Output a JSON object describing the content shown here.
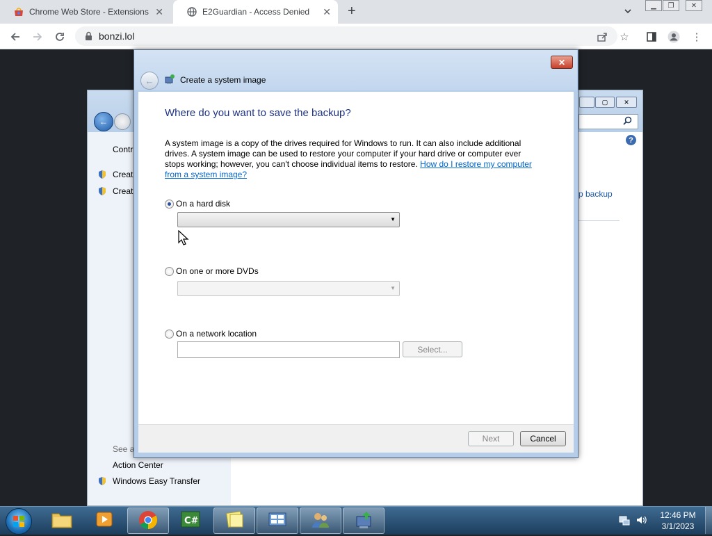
{
  "browser": {
    "tabs": [
      {
        "label": "Chrome Web Store - Extensions",
        "active": false
      },
      {
        "label": "E2Guardian - Access Denied",
        "active": true
      }
    ],
    "url": "bonzi.lol"
  },
  "background_window": {
    "left_links_top": [
      "Contr",
      "Creat",
      "Creat"
    ],
    "see_also": "See al",
    "see_also_links": [
      "Action Center",
      "Windows Easy Transfer"
    ],
    "right_link": "p backup"
  },
  "dialog": {
    "title": "Create a system image",
    "heading": "Where do you want to save the backup?",
    "description": "A system image is a copy of the drives required for Windows to run. It can also include additional drives. A system image can be used to restore your computer if your hard drive or computer ever stops working; however, you can't choose individual items to restore.",
    "help_link": "How do I restore my computer from a system image?",
    "options": {
      "hard_disk": {
        "label": "On a hard disk",
        "selected": true,
        "value": ""
      },
      "dvds": {
        "label": "On one or more DVDs",
        "selected": false,
        "value": ""
      },
      "network": {
        "label": "On a network location",
        "selected": false,
        "value": "",
        "select_button": "Select..."
      }
    },
    "next_button": "Next",
    "cancel_button": "Cancel"
  },
  "taskbar": {
    "time": "12:46 PM",
    "date": "3/1/2023"
  }
}
